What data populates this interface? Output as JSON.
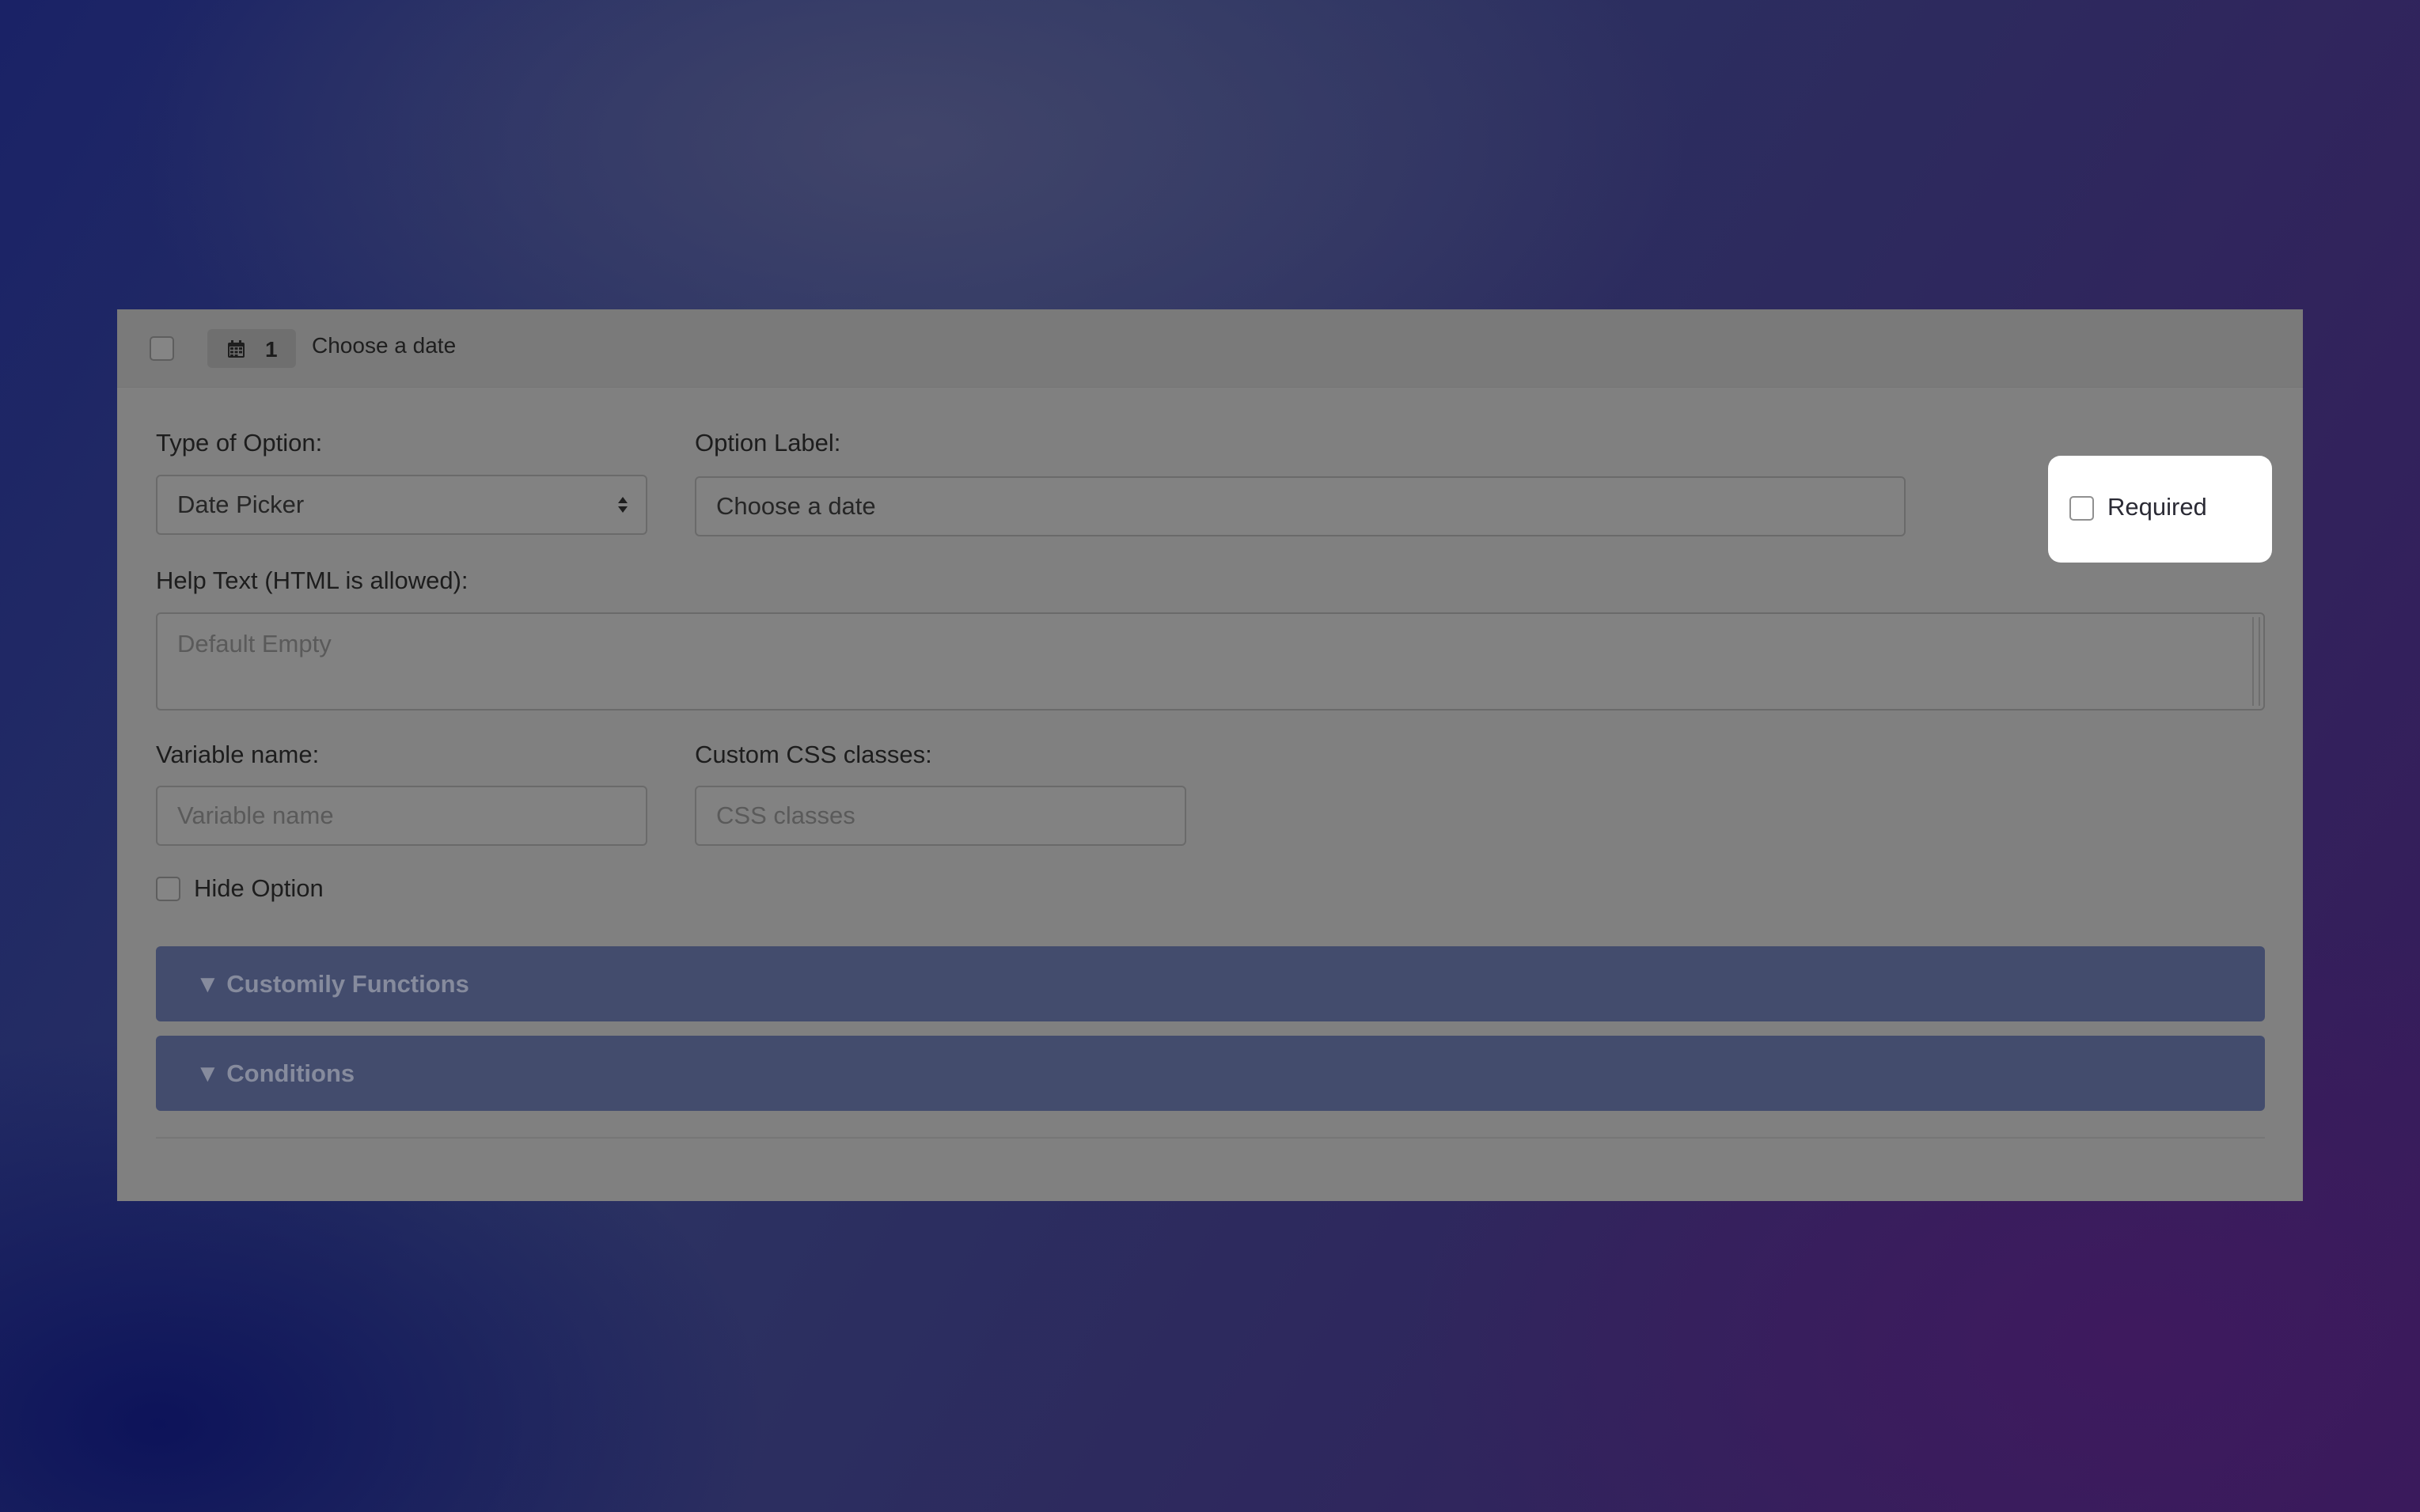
{
  "header": {
    "badge_number": "1",
    "title": "Choose a date",
    "icon": "calendar-icon"
  },
  "form": {
    "type_of_option": {
      "label": "Type of Option:",
      "value": "Date Picker"
    },
    "option_label": {
      "label": "Option Label:",
      "value": "Choose a date"
    },
    "required": {
      "label": "Required",
      "checked": false
    },
    "help_text": {
      "label": "Help Text (HTML is allowed):",
      "placeholder": "Default Empty"
    },
    "variable_name": {
      "label": "Variable name:",
      "placeholder": "Variable name"
    },
    "custom_css": {
      "label": "Custom CSS classes:",
      "placeholder": "CSS classes"
    },
    "hide_option": {
      "label": "Hide Option",
      "checked": false
    }
  },
  "sections": [
    {
      "label": "▼ Customily Functions"
    },
    {
      "label": "▼ Conditions"
    }
  ],
  "colors": {
    "accordion_bg": "#434c6d",
    "highlight_bg": "#ffffff"
  }
}
